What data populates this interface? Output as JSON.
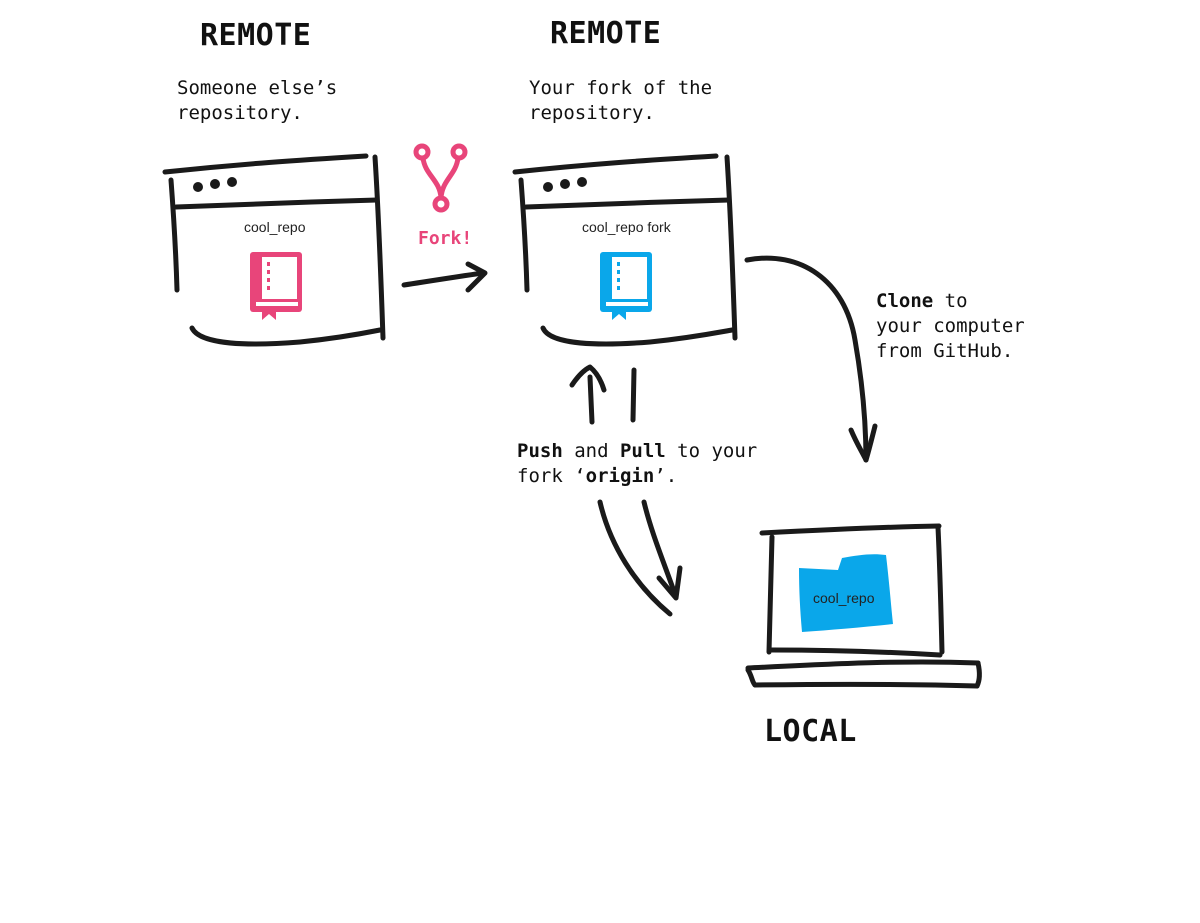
{
  "colors": {
    "ink": "#1a1a1a",
    "pink": "#e8457a",
    "blue": "#0aa7ea"
  },
  "upstream": {
    "heading": "REMOTE",
    "caption_line1": "Someone else’s",
    "caption_line2": "repository.",
    "window_label": "cool_repo",
    "icon": "book-icon"
  },
  "fork": {
    "heading": "REMOTE",
    "caption_line1": "Your fork of the",
    "caption_line2": "repository.",
    "window_label": "cool_repo fork",
    "icon": "book-icon",
    "action_label": "Fork!",
    "action_icon": "git-fork-icon"
  },
  "clone": {
    "bold": "Clone",
    "line1_rest": " to",
    "line2": "your computer",
    "line3": "from GitHub."
  },
  "sync": {
    "push": "Push",
    "and": " and ",
    "pull": "Pull",
    "line1_rest": " to your",
    "line2_start": "fork ‘",
    "origin": "origin",
    "line2_end": "’."
  },
  "local": {
    "heading": "LOCAL",
    "folder_label": "cool_repo",
    "icon": "folder-icon"
  }
}
